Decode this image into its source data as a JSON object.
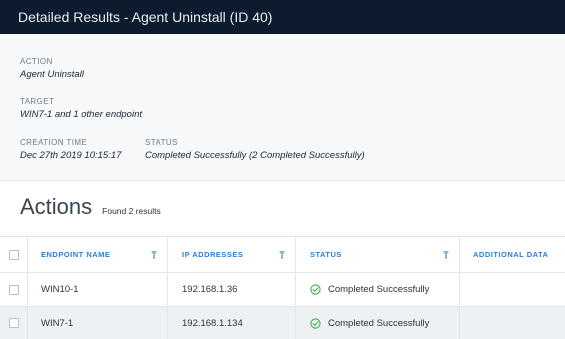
{
  "window": {
    "title": "Detailed Results - Agent Uninstall (ID 40)"
  },
  "details": {
    "action": {
      "label": "ACTION",
      "value": "Agent Uninstall"
    },
    "target": {
      "label": "TARGET",
      "value": "WIN7-1 and 1 other endpoint"
    },
    "creation_time": {
      "label": "CREATION TIME",
      "value": "Dec 27th 2019 10:15:17"
    },
    "status": {
      "label": "STATUS",
      "value": "Completed Successfully (2 Completed Successfully)"
    }
  },
  "actions": {
    "title": "Actions",
    "count_text": "Found 2 results",
    "columns": [
      {
        "label": "ENDPOINT NAME"
      },
      {
        "label": "IP ADDRESSES"
      },
      {
        "label": "STATUS"
      },
      {
        "label": "ADDITIONAL DATA"
      }
    ],
    "rows": [
      {
        "endpoint": "WIN10-1",
        "ip": "192.168.1.36",
        "status": "Completed Successfully",
        "additional": ""
      },
      {
        "endpoint": "WIN7-1",
        "ip": "192.168.1.134",
        "status": "Completed Successfully",
        "additional": ""
      }
    ]
  },
  "icons": {
    "filter": "filter-icon",
    "success": "check-circle-icon"
  },
  "colors": {
    "titlebar_bg": "#0d1b2e",
    "header_accent": "#2a7fd4",
    "success": "#3fae49"
  }
}
